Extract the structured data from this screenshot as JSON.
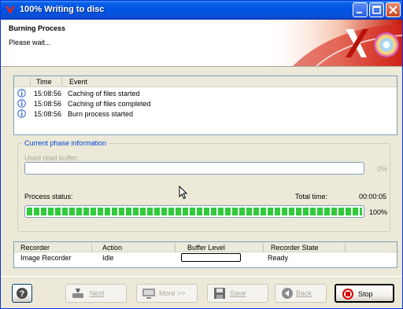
{
  "window": {
    "title": "100% Writing to disc"
  },
  "header": {
    "title": "Burning Process",
    "subtitle": "Please wait..."
  },
  "log": {
    "columns": [
      "Time",
      "Event"
    ],
    "rows": [
      {
        "time": "15:08:56",
        "event": "Caching of files started"
      },
      {
        "time": "15:08:56",
        "event": "Caching of files completed"
      },
      {
        "time": "15:08:56",
        "event": "Burn process started"
      }
    ]
  },
  "phase": {
    "group_title": "Current phase information",
    "used_buffer_label": "Used read buffer:",
    "used_buffer_pct": "0%",
    "process_status_label": "Process status:",
    "total_time_label": "Total time:",
    "total_time": "00:00:05",
    "progress_pct": "100%",
    "progress_fraction": 1.0
  },
  "recorder": {
    "columns": [
      "Recorder",
      "Action",
      "Buffer Level",
      "Recorder State"
    ],
    "row": {
      "recorder": "Image Recorder",
      "action": "Idle",
      "state": "Ready"
    }
  },
  "buttons": {
    "next": "Next",
    "more": "More >>",
    "save": "Save",
    "back": "Back",
    "stop": "Stop"
  },
  "colors": {
    "titlebar": "#0054e3",
    "progress": "#2fcb3b",
    "group_title": "#0046d5",
    "stop_icon": "#d40000"
  }
}
